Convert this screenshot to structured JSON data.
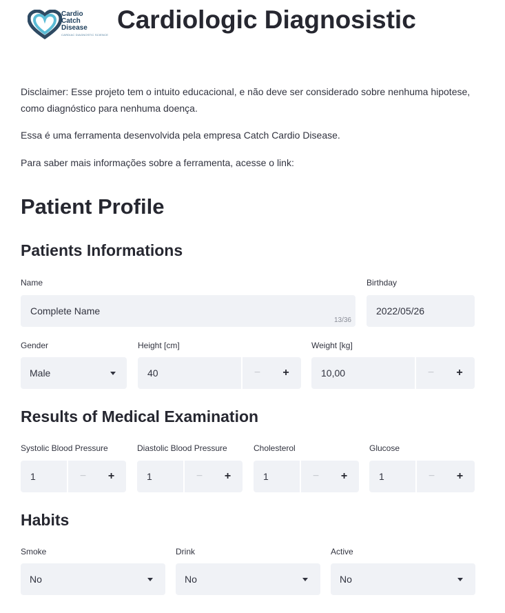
{
  "header": {
    "logo_lines": [
      "Cardio",
      "Catch",
      "Disease"
    ],
    "logo_tagline": "CARDIAC DIAGNOSTIC SCIENCE",
    "title": "Cardiologic Diagnosistic"
  },
  "intro": {
    "disclaimer": "Disclaimer: Esse projeto tem o intuito educacional, e não deve ser considerado sobre nenhuma hipotese, como diagnóstico para nenhuma doença.",
    "company": "Essa é uma ferramenta desenvolvida pela empresa Catch Cardio Disease.",
    "link_text": "Para saber mais informações sobre a ferramenta, acesse o link:"
  },
  "profile": {
    "title": "Patient Profile",
    "info_title": "Patients Informations",
    "name": {
      "label": "Name",
      "value": "Complete Name",
      "counter": "13/36"
    },
    "birthday": {
      "label": "Birthday",
      "value": "2022/05/26"
    },
    "gender": {
      "label": "Gender",
      "value": "Male"
    },
    "height": {
      "label": "Height [cm]",
      "value": "40"
    },
    "weight": {
      "label": "Weight [kg]",
      "value": "10,00"
    }
  },
  "exam": {
    "title": "Results of Medical Examination",
    "systolic": {
      "label": "Systolic Blood Pressure",
      "value": "1"
    },
    "diastolic": {
      "label": "Diastolic Blood Pressure",
      "value": "1"
    },
    "cholesterol": {
      "label": "Cholesterol",
      "value": "1"
    },
    "glucose": {
      "label": "Glucose",
      "value": "1"
    }
  },
  "habits": {
    "title": "Habits",
    "smoke": {
      "label": "Smoke",
      "value": "No"
    },
    "drink": {
      "label": "Drink",
      "value": "No"
    },
    "active": {
      "label": "Active",
      "value": "No"
    }
  },
  "stepper": {
    "minus": "−",
    "plus": "+"
  },
  "colors": {
    "input_bg": "#f0f2f6",
    "text": "#31333f",
    "logo_dark": "#2e4a63",
    "logo_light": "#5bbcd6"
  }
}
